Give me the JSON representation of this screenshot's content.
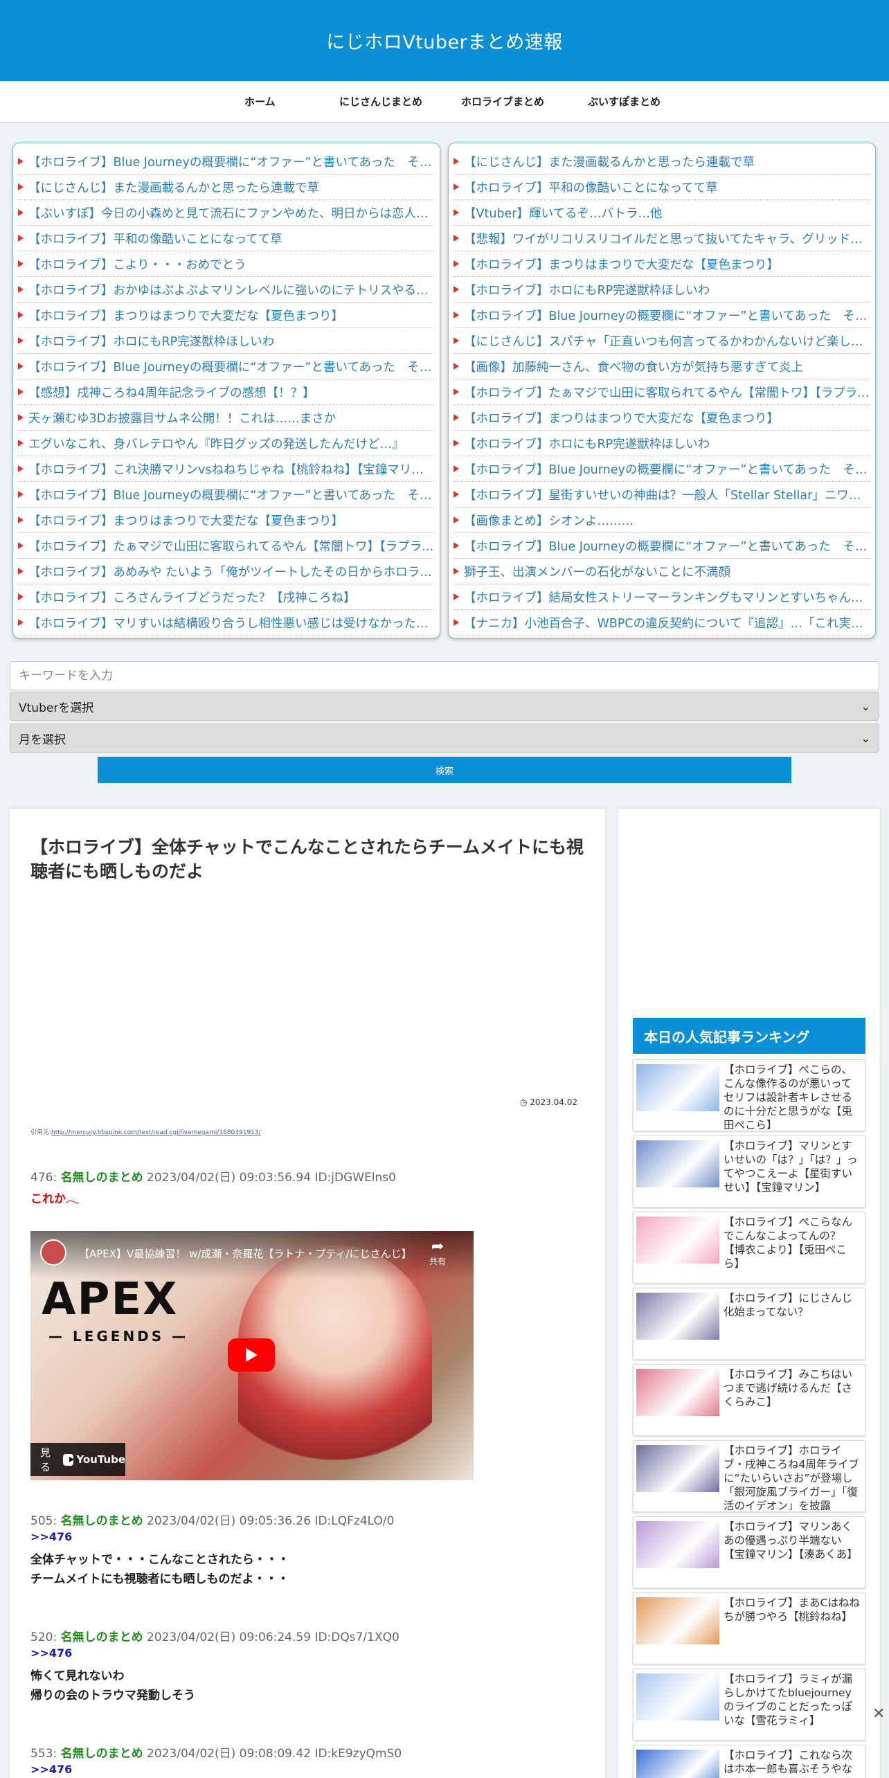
{
  "site": {
    "title": "にじホロVtuberまとめ速報"
  },
  "nav": [
    {
      "label": "ホーム"
    },
    {
      "label": "にじさんじまとめ"
    },
    {
      "label": "ホロライブまとめ"
    },
    {
      "label": "ぶいすぽまとめ"
    }
  ],
  "feed_left": [
    "【ホロライブ】Blue Journeyの概要欄に“オファー”と書いてあった　その理由は…",
    "【にじさんじ】また漫画載るんかと思ったら連載で草",
    "【ぶいすぽ】今日の小森めと見て流石にファンやめた、明日からは恋人になります",
    "【ホロライブ】平和の像酷いことになってて草",
    "【ホロライブ】こより・・・おめでとう",
    "【ホロライブ】おかゆはぷよぷよマリンレベルに強いのにテトリスやると弱い",
    "【ホロライブ】まつりはまつりで大変だな【夏色まつり】",
    "【ホロライブ】ホロにもRP完遂獣枠ほしいわ",
    "【ホロライブ】Blue Journeyの概要欄に“オファー”と書いてあった　その理由は…",
    "【感想】戌神ころね4周年記念ライブの感想【！？】",
    "天ヶ瀬むゆ3Dお披露目サムネ公開！！これは……まさか",
    "エグいなこれ、身バレテロやん『昨日グッズの発送したんだけど…』",
    "【ホロライブ】これ決勝マリンvsねねちじゃね【桃鈴ねね】【宝鐘マリン】",
    "【ホロライブ】Blue Journeyの概要欄に“オファー”と書いてあった　その理由は…",
    "【ホロライブ】まつりはまつりで大変だな【夏色まつり】",
    "【ホロライブ】たぁマジで山田に客取られてるやん【常闇トワ】【ラプラス】",
    "【ホロライブ】あめみや たいよう「俺がツイートしたその日からホロライブが…",
    "【ホロライブ】ころさんライブどうだった？【戌神ころね】",
    "【ホロライブ】マリすいは結構殴り合うし相性悪い感じは受けなかったけど…"
  ],
  "feed_right": [
    "【にじさんじ】また漫画載るんかと思ったら連載で草",
    "【ホロライブ】平和の像酷いことになってて草",
    "【Vtuber】輝いてるぞ…バトラ…他",
    "【悲報】ワイがリコリスリコイルだと思って抜いてたキャラ、グリッドマンだった",
    "【ホロライブ】まつりはまつりで大変だな【夏色まつり】",
    "【ホロライブ】ホロにもRP完遂獣枠ほしいわ",
    "【ホロライブ】Blue Journeyの概要欄に“オファー”と書いてあった　その理由は…",
    "【にじさんじ】スパチャ「正直いつも何言ってるかわかんないけど楽しい」",
    "【画像】加藤純一さん、食べ物の食い方が気持ち悪すぎて炎上",
    "【ホロライブ】たぁマジで山田に客取られてるやん【常闇トワ】【ラプラス】",
    "【ホロライブ】まつりはまつりで大変だな【夏色まつり】",
    "【ホロライブ】ホロにもRP完遂獣枠ほしいわ",
    "【ホロライブ】Blue Journeyの概要欄に“オファー”と書いてあった　その理由は…",
    "【ホロライブ】星街すいせいの神曲は？一般人「Stellar Stellar」ニワカ「…」",
    "【画像まとめ】シオンよ………",
    "【ホロライブ】Blue Journeyの概要欄に“オファー”と書いてあった　その理由は…",
    "獅子王、出演メンバーの石化がないことに不満顔",
    "【ホロライブ】結局女性ストリーマーランキングもマリンとすいちゃんがトップ",
    "【ナニカ】小池百合子、WBPCの違反契約について『追認』…「これ実質…」"
  ],
  "search": {
    "placeholder": "キーワードを入力",
    "vtuber_select": "Vtuberを選択",
    "month_select": "月を選択",
    "button": "検索"
  },
  "article": {
    "title": "【ホロライブ】全体チャットでこんなことされたらチームメイトにも視聴者にも晒しものだよ",
    "date": "2023.04.02",
    "source_label": "引用元:",
    "source_url": "http://mercury.bbspink.com/test/read.cgi/livemegami/1680391913/",
    "video": {
      "title": "【APEX】V最協練習！ w/成瀬・奈羅花【ラトナ・プティ/にじさんじ】",
      "share": "共有",
      "watch": "見る",
      "yt": "YouTube",
      "apex": "APEX",
      "legends": "— LEGENDS —"
    },
    "comments": [
      {
        "num": "476:",
        "name": "名無しのまとめ",
        "meta": "2023/04/02(日) 09:03:56.94 ID:jDGWElns0",
        "lines": [
          "これか𓂃"
        ]
      },
      {
        "num": "505:",
        "name": "名無しのまとめ",
        "meta": "2023/04/02(日) 09:05:36.26 ID:LQFz4LO/0",
        "reply": ">>476",
        "lines": [
          "全体チャットで・・・こんなことされたら・・・",
          "チームメイトにも視聴者にも晒しものだよ・・・"
        ]
      },
      {
        "num": "520:",
        "name": "名無しのまとめ",
        "meta": "2023/04/02(日) 09:06:24.59 ID:DQs7/1XQ0",
        "reply": ">>476",
        "lines": [
          "怖くて見れないわ",
          "帰りの会のトラウマ発動しそう"
        ]
      },
      {
        "num": "553:",
        "name": "名無しのまとめ",
        "meta": "2023/04/02(日) 09:08:09.42 ID:kE9zyQmS0",
        "reply": ">>476",
        "lines": []
      }
    ]
  },
  "sidebar": {
    "ranking_title": "本日の人気記事ランキング",
    "items": [
      {
        "text": "【ホロライブ】ぺこらの、こんな像作るのが悪いってセリフは設計者キレさせるのに十分だと思うがな【兎田ぺこら】",
        "thumb": "#8fb6e8"
      },
      {
        "text": "【ホロライブ】マリンとすいせいの「は？」「は？」ってやつこえーよ【星街すいせい】【宝鐘マリン】",
        "thumb": "#6f8fc8"
      },
      {
        "text": "【ホロライブ】ぺこらなんでこんなこよってんの？【博衣こより】【兎田ぺこら】",
        "thumb": "#f2a7c3"
      },
      {
        "text": "【ホロライブ】にじさんじ化始まってない？",
        "thumb": "#7b7aa8"
      },
      {
        "text": "【ホロライブ】みこちはいつまで逃げ続けるんだ【さくらみこ】",
        "thumb": "#e27a8a"
      },
      {
        "text": "【ホロライブ】ホロライブ・戌神ころね4周年ライブに“たいらいさお”が登場し「銀河旋風ブライガー」「復活のイデオン」を披露",
        "thumb": "#6b6f9e"
      },
      {
        "text": "【ホロライブ】マリンあくあの優遇っぷり半端ない【宝鐘マリン】【湊あくあ】",
        "thumb": "#b89ad8"
      },
      {
        "text": "【ホロライブ】まあCはねねちが勝つやろ【桃鈴ねね】",
        "thumb": "#e39a5c"
      },
      {
        "text": "【ホロライブ】ラミィが漏らしかけてたbluejourneyのライブのことだったっぽいな【雪花ラミィ】",
        "thumb": "#a9c9ee"
      },
      {
        "text": "【ホロライブ】これなら次はホ本一郎も喜ぶそうやな",
        "thumb": "#3d6fd8"
      }
    ]
  },
  "ui": {
    "close": "✕",
    "chevron": "⌄"
  }
}
